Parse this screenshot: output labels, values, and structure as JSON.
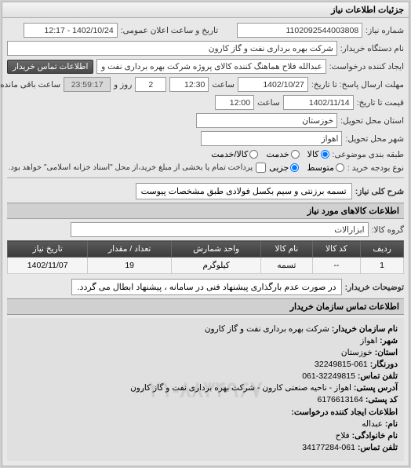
{
  "panel_title": "جزئیات اطلاعات نیاز",
  "fields": {
    "req_no_label": "شماره نیاز:",
    "req_no": "1102092544003808",
    "pub_date_label": "تاریخ و ساعت اعلان عمومی:",
    "pub_date": "1402/10/24 - 12:17",
    "buyer_org_label": "نام دستگاه خریدار:",
    "buyer_org": "شرکت بهره برداری نفت و گاز کارون",
    "creator_label": "ایجاد کننده درخواست:",
    "creator": "عبدالله فلاح هماهنگ کننده کالای پروژه شرکت بهره برداری نفت و گاز کارون",
    "contact_btn": "اطلاعات تماس خریدار",
    "resp_deadline_label": "مهلت ارسال پاسخ: تا تاریخ:",
    "resp_date": "1402/10/27",
    "time_label": "ساعت",
    "resp_time": "12:30",
    "days_unit": "روز و",
    "days": "2",
    "remaining_time": "23:59:17",
    "remaining_label": "ساعت باقی مانده",
    "price_date_label": "قیمت تا تاریخ:",
    "price_date": "1402/11/14",
    "price_time": "12:00",
    "delivery_prov_label": "استان محل تحویل:",
    "delivery_prov": "خوزستان",
    "delivery_city_label": "شهر محل تحویل:",
    "delivery_city": "اهواز",
    "class_label": "طبقه بندی موضوعی:",
    "class_opt1": "کالا",
    "class_opt2": "خدمت",
    "class_opt3": "کالا/خدمت",
    "buy_type_label": "نوع بودجه خرید :",
    "buy_opt1": "متوسط",
    "buy_opt2": "جزیی",
    "buy_note": "پرداخت تمام یا بخشی از مبلغ خرید،از محل \"اسناد خزانه اسلامی\" خواهد بود.",
    "desc_label": "شرح کلی نیاز:",
    "desc": "تسمه برزنتی و سیم بکسل فولادی طبق مشخصات پیوست",
    "goods_section": "اطلاعات کالاهای مورد نیاز",
    "group_label": "گروه کالا:",
    "group": "ابزارآلات",
    "explain_label": "توضیحات خریدار:",
    "explain": "در صورت عدم بارگذاری پیشنهاد فنی در سامانه ، پیشنهاد ابطال می گردد."
  },
  "table": {
    "headers": [
      "ردیف",
      "کد کالا",
      "نام کالا",
      "واحد شمارش",
      "تعداد / مقدار",
      "تاریخ نیاز"
    ],
    "rows": [
      {
        "idx": "1",
        "code": "--",
        "name": "تسمه",
        "unit": "کیلوگرم",
        "qty": "19",
        "date": "1402/11/07"
      }
    ]
  },
  "contact": {
    "section_title": "اطلاعات تماس سازمان خریدار",
    "org_label": "نام سازمان خریدار:",
    "org": "شرکت بهره برداری نفت و گاز کارون",
    "city_label": "شهر:",
    "city": "اهواز",
    "prov_label": "استان:",
    "prov": "خوزستان",
    "phone_label": "دورنگار:",
    "phone": "061-32249815",
    "fax_label": "تلفن تماس:",
    "fax": "32249815-061",
    "addr_label": "آدرس پستی:",
    "addr": "اهواز - ناحیه صنعتی کارون - شرکت بهره برداری نفت و گاز کارون",
    "post_label": "کد پستی:",
    "post": "6176613164",
    "creator_section": "اطلاعات ایجاد کننده درخواست:",
    "name_label": "نام:",
    "name": "عبداله",
    "lname_label": "نام خانوادگی:",
    "lname": "فلاح",
    "cphone_label": "تلفن تماس:",
    "cphone": "061-34177284",
    "watermark": "۰۲۱-۸۸۳۴۹۶۷۰"
  }
}
